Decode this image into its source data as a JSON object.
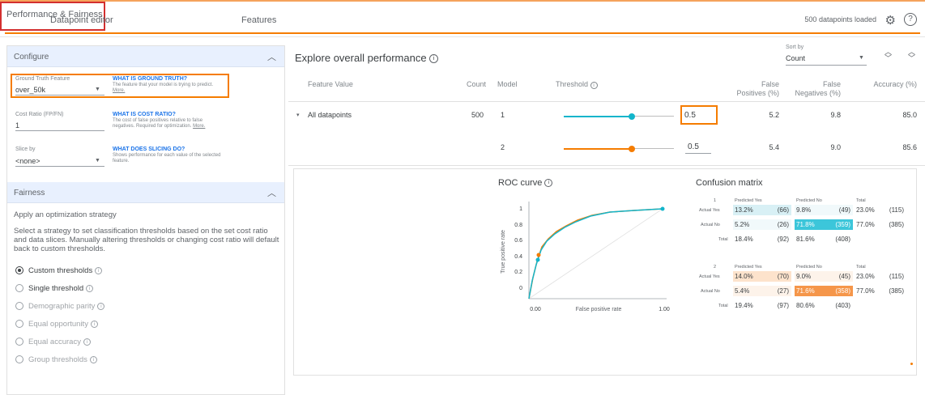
{
  "tabs": {
    "datapoint_editor": "Datapoint editor",
    "performance": "Performance & Fairness",
    "features": "Features"
  },
  "header": {
    "loaded": "500 datapoints loaded",
    "settings_icon": "gear-icon",
    "help_icon": "help-icon"
  },
  "configure": {
    "title": "Configure",
    "ground_truth_label": "Ground Truth Feature",
    "ground_truth_value": "over_50k",
    "gt_q": "WHAT IS GROUND TRUTH?",
    "gt_desc": "The feature that your model is trying to predict.",
    "gt_more": "More.",
    "cost_label": "Cost Ratio (FP/FN)",
    "cost_value": "1",
    "cost_q": "WHAT IS COST RATIO?",
    "cost_desc": "The cost of false positives relative to false negatives. Required for optimization.",
    "cost_more": "More.",
    "slice_label": "Slice by",
    "slice_value": "<none>",
    "slice_q": "WHAT DOES SLICING DO?",
    "slice_desc": "Shows performance for each value of the selected feature."
  },
  "fairness": {
    "title": "Fairness",
    "apply": "Apply an optimization strategy",
    "desc": "Select a strategy to set classification thresholds based on the set cost ratio and data slices. Manually altering thresholds or changing cost ratio will default back to custom thresholds.",
    "options": [
      {
        "label": "Custom thresholds",
        "selected": true,
        "enabled": true
      },
      {
        "label": "Single threshold",
        "selected": false,
        "enabled": true
      },
      {
        "label": "Demographic parity",
        "selected": false,
        "enabled": false
      },
      {
        "label": "Equal opportunity",
        "selected": false,
        "enabled": false
      },
      {
        "label": "Equal accuracy",
        "selected": false,
        "enabled": false
      },
      {
        "label": "Group thresholds",
        "selected": false,
        "enabled": false
      }
    ]
  },
  "explore": {
    "title": "Explore overall performance",
    "sort_by_label": "Sort by",
    "sort_by_value": "Count",
    "columns": [
      "Feature Value",
      "Count",
      "Model",
      "Threshold",
      "False Positives (%)",
      "False Negatives (%)",
      "Accuracy (%)"
    ],
    "row": {
      "name": "All datapoints",
      "count": "500",
      "models": [
        {
          "model": "1",
          "threshold": "0.5",
          "fp": "5.2",
          "fn": "9.8",
          "acc": "85.0",
          "color": "#12b5cb",
          "slider_level": 0.62
        },
        {
          "model": "2",
          "threshold": "0.5",
          "fp": "5.4",
          "fn": "9.0",
          "acc": "85.6",
          "color": "#f57c00",
          "slider_level": 0.62
        }
      ]
    }
  },
  "roc": {
    "title": "ROC curve",
    "ylabel": "True positive rate",
    "xlabel": "False positive rate",
    "y_ticks": [
      "1",
      "0.8",
      "0.6",
      "0.4",
      "0.2",
      "0"
    ],
    "x_ticks": [
      "0.00",
      "1.00"
    ]
  },
  "confusion": {
    "title": "Confusion matrix",
    "head_yes": "Predicted Yes",
    "head_no": "Predicted No",
    "head_total": "Total",
    "actual_yes": "Actual Yes",
    "actual_no": "Actual No",
    "total": "Total",
    "models": [
      {
        "id": "1",
        "yes_yes_pct": "13.2%",
        "yes_yes_n": "(66)",
        "yes_no_pct": "9.8%",
        "yes_no_n": "(49)",
        "yes_tot_pct": "23.0%",
        "yes_tot_n": "(115)",
        "no_yes_pct": "5.2%",
        "no_yes_n": "(26)",
        "no_no_pct": "71.8%",
        "no_no_n": "(359)",
        "no_tot_pct": "77.0%",
        "no_tot_n": "(385)",
        "tot_yes_pct": "18.4%",
        "tot_yes_n": "(92)",
        "tot_no_pct": "81.6%",
        "tot_no_n": "(408)"
      },
      {
        "id": "2",
        "yes_yes_pct": "14.0%",
        "yes_yes_n": "(70)",
        "yes_no_pct": "9.0%",
        "yes_no_n": "(45)",
        "yes_tot_pct": "23.0%",
        "yes_tot_n": "(115)",
        "no_yes_pct": "5.4%",
        "no_yes_n": "(27)",
        "no_no_pct": "71.6%",
        "no_no_n": "(358)",
        "no_tot_pct": "77.0%",
        "no_tot_n": "(385)",
        "tot_yes_pct": "19.4%",
        "tot_yes_n": "(97)",
        "tot_no_pct": "80.6%",
        "tot_no_n": "(403)"
      }
    ]
  }
}
